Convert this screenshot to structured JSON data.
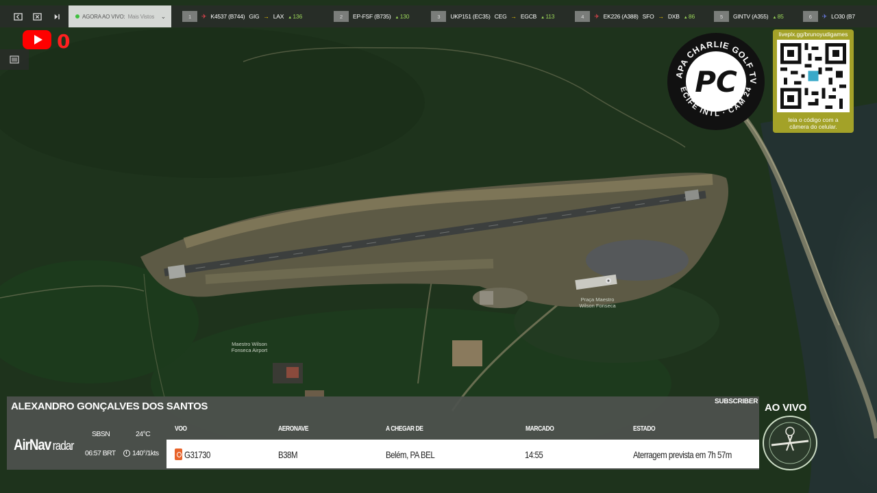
{
  "top_bar": {
    "now_label": "AGORA AO VIVO:",
    "now_value": "Mais Vistos",
    "flights": [
      {
        "rank": "1",
        "flight": "K4537 (B744)",
        "origin": "GIG",
        "destination": "LAX",
        "count": "136"
      },
      {
        "rank": "2",
        "flight": "EP-FSF (B735)",
        "origin": "",
        "destination": "",
        "count": "130"
      },
      {
        "rank": "3",
        "flight": "UKP151 (EC35)",
        "origin": "CEG",
        "destination": "EGCB",
        "count": "113"
      },
      {
        "rank": "4",
        "flight": "EK226 (A388)",
        "origin": "SFO",
        "destination": "DXB",
        "count": "86"
      },
      {
        "rank": "5",
        "flight": "GINTV (A355)",
        "origin": "",
        "destination": "",
        "count": "85"
      },
      {
        "rank": "6",
        "flight": "LO30 (B7",
        "origin": "",
        "destination": "",
        "count": ""
      }
    ]
  },
  "youtube": {
    "count": "0"
  },
  "map": {
    "airport_label_line1": "Maestro Wilson",
    "airport_label_line2": "Fonseca Airport",
    "poi_line1": "Praça Maestro",
    "poi_line2": "Wilson Fonseca"
  },
  "logo": {
    "top_text": "PAPA CHARLIE GOLF TV",
    "bottom_text": "RECIFE INTL · CAM 24H",
    "monogram": "PC"
  },
  "qr": {
    "url": "liveplx.gg/brunoyudigames",
    "caption_line1": "leia o código com a",
    "caption_line2": "câmera do celular."
  },
  "airnav": {
    "subscriber_label": "SUBSCRIBER",
    "subscriber_name": "ALEXANDRO GONÇALVES DOS SANTOS",
    "brand_bold": "AirNav",
    "brand_light": "radar",
    "icao": "SBSN",
    "temperature": "24°C",
    "local_time": "06:57 BRT",
    "wind": "140°/1kts",
    "columns": {
      "flight": "VOO",
      "aircraft": "AERONAVE",
      "arriving_from": "A CHEGAR DE",
      "scheduled": "MARCADO",
      "status": "ESTADO"
    },
    "row": {
      "flight": "G31730",
      "aircraft": "B38M",
      "arriving_from": "Belém, PA BEL",
      "scheduled": "14:55",
      "status": "Aterragem prevista em 7h 57m"
    }
  },
  "live": {
    "label": "AO VIVO"
  },
  "colors": {
    "accent_red": "#ff0000",
    "qr_card": "#a3a228",
    "count_green": "#9bd65a",
    "arrow_yellow": "#ffd400"
  }
}
